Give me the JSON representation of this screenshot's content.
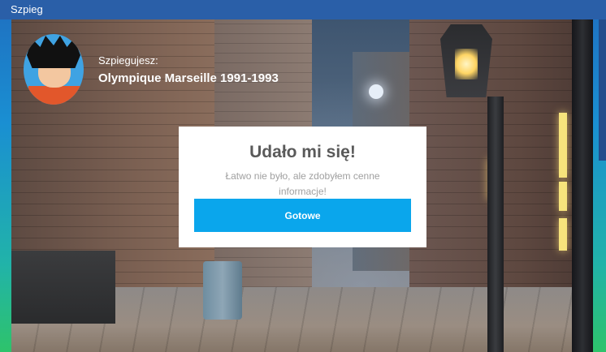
{
  "window": {
    "title": "Szpieg"
  },
  "profile": {
    "avatar_icon": "cartoon-avatar-icon",
    "subtitle": "Szpiegujesz:",
    "team_name": "Olympique Marseille 1991-1993"
  },
  "dialog": {
    "title": "Udało mi się!",
    "message": "Łatwo nie było, ale zdobyłem cenne informacje!",
    "button_label": "Gotowe",
    "button_color": "#0aa6ec"
  },
  "colors": {
    "title_bar": "#2a5fa8",
    "dialog_title": "#5a5a5a",
    "dialog_message": "#a0a0a0"
  }
}
